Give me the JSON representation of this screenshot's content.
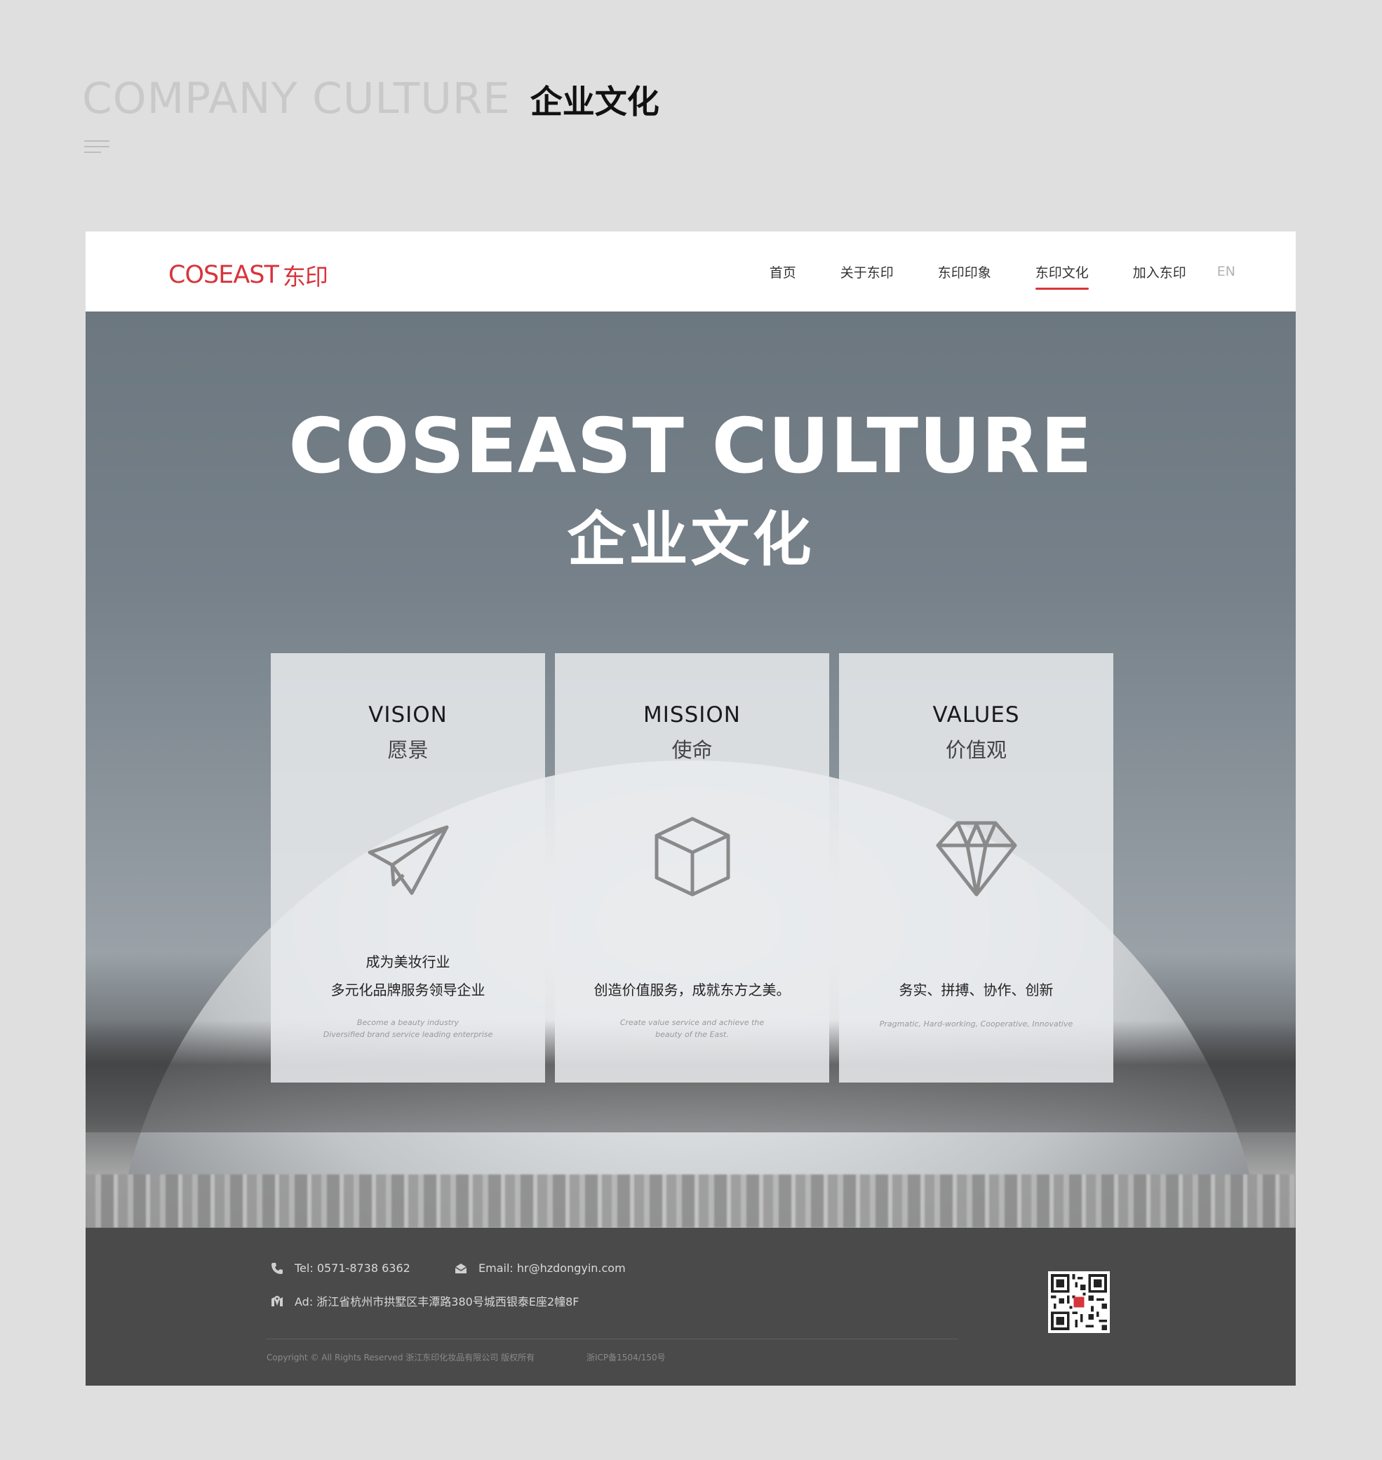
{
  "page_heading": {
    "en": "COMPANY CULTURE",
    "cn": "企业文化"
  },
  "menu_icon": "hamburger-icon",
  "site": {
    "logo": {
      "en": "COSEAST",
      "cn": "东印",
      "color": "#d8343c"
    },
    "nav": [
      {
        "label": "首页",
        "active": false
      },
      {
        "label": "关于东印",
        "active": false
      },
      {
        "label": "东印印象",
        "active": false
      },
      {
        "label": "东印文化",
        "active": true
      },
      {
        "label": "加入东印",
        "active": false
      }
    ],
    "lang": "EN",
    "hero": {
      "title": "COSEAST CULTURE",
      "subtitle": "企业文化"
    },
    "cards": [
      {
        "title": "VISION",
        "subtitle": "愿景",
        "icon": "paper-plane-icon",
        "text": [
          "成为美妆行业",
          "多元化品牌服务领导企业"
        ],
        "en": [
          "Become a beauty industry",
          "Diversified brand service leading enterprise"
        ]
      },
      {
        "title": "MISSION",
        "subtitle": "使命",
        "icon": "cube-icon",
        "text": [
          "创造价值服务，成就东方之美。"
        ],
        "en": [
          "Create value service and achieve the",
          "beauty of the East."
        ]
      },
      {
        "title": "VALUES",
        "subtitle": "价值观",
        "icon": "diamond-icon",
        "text": [
          "务实、拼搏、协作、创新"
        ],
        "en": [
          "Pragmatic,  Hard-working,  Cooperative,  Innovative"
        ]
      }
    ],
    "footer": {
      "tel": "Tel: 0571-8738 6362",
      "email": "Email: hr@hzdongyin.com",
      "address": "Ad: 浙江省杭州市拱墅区丰潭路380号城西银泰E座2幢8F",
      "copyright": "Copyright © All Rights Reserved 浙江东印化妆品有限公司  版权所有",
      "icp": "浙ICP备1504/150号",
      "qr": "qr-code-icon"
    }
  }
}
